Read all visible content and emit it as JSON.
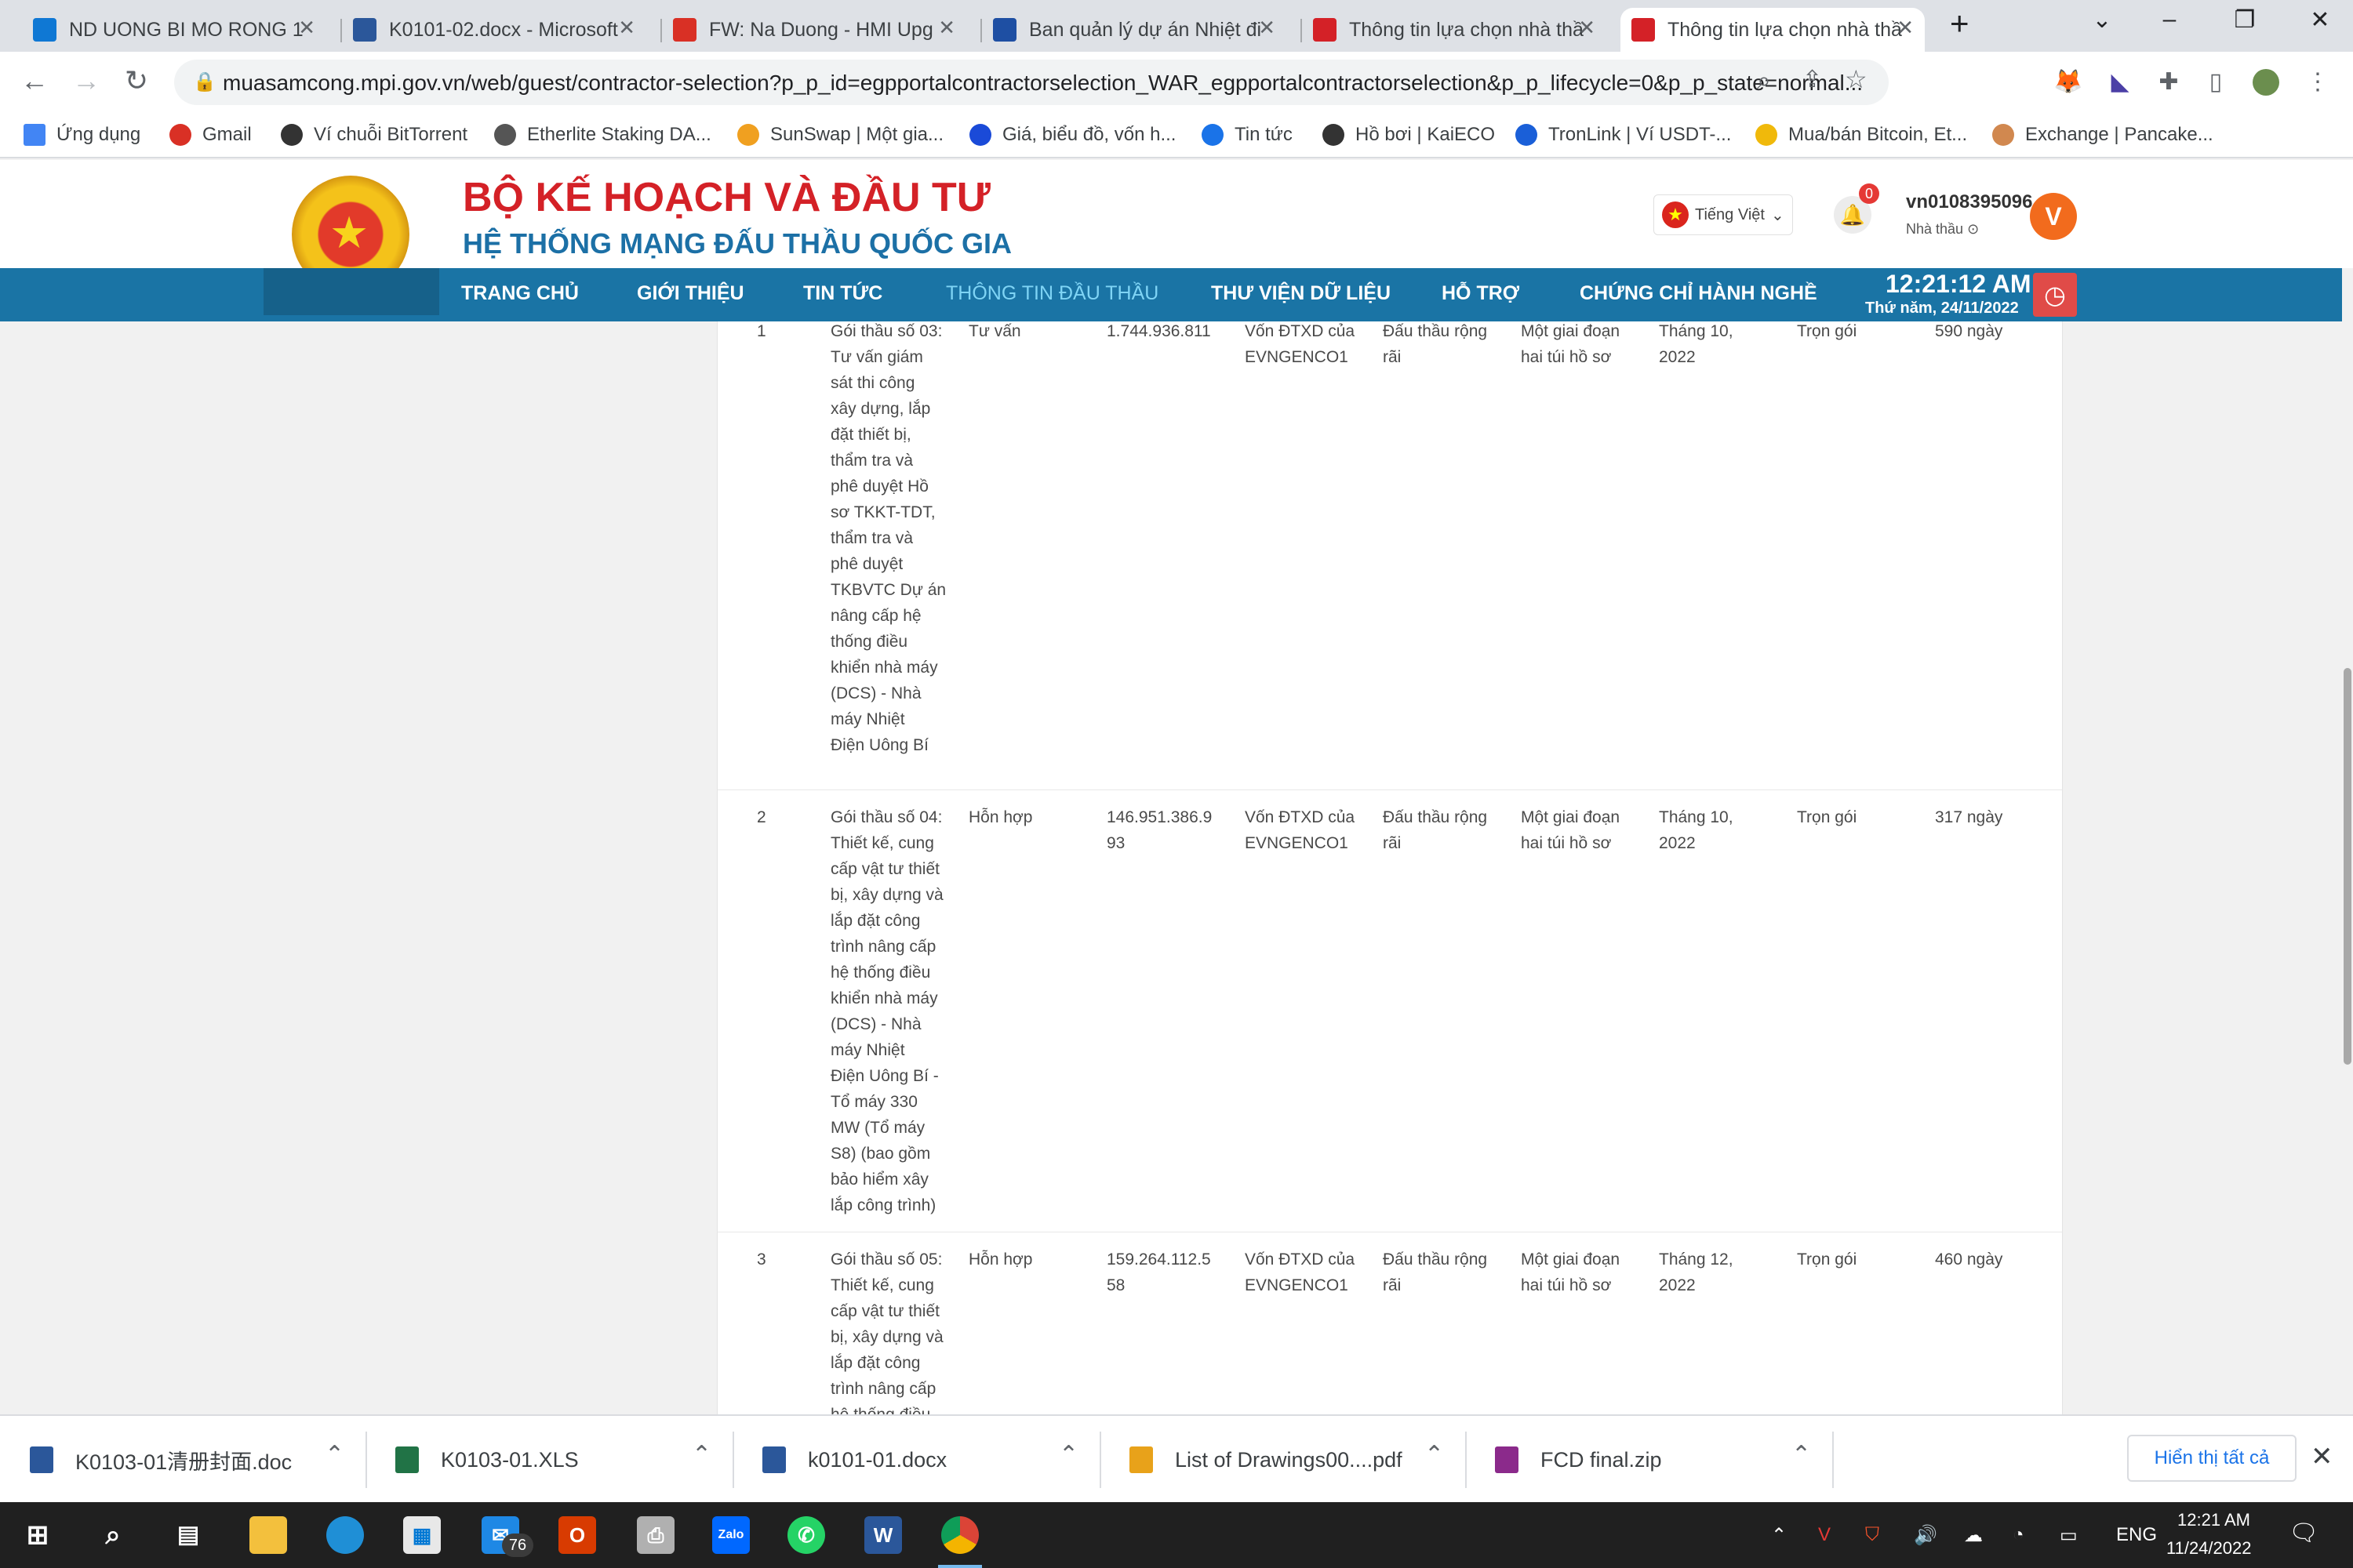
{
  "browser": {
    "tabs": [
      {
        "label": "ND UONG BI MO RONG 1",
        "icon": "onedrive-icon",
        "color": "#0f78d4"
      },
      {
        "label": "K0101-02.docx - Microsoft",
        "icon": "word-icon",
        "color": "#2b579a"
      },
      {
        "label": "FW: Na Duong - HMI Upg",
        "icon": "gmail-icon",
        "color": "#d93025"
      },
      {
        "label": "Ban quản lý dự án Nhiệt đi",
        "icon": "evn-icon",
        "color": "#1e4fa3"
      },
      {
        "label": "Thông tin lựa chọn nhà thầ",
        "icon": "emblem-icon",
        "color": "#d42127"
      },
      {
        "label": "Thông tin lựa chọn nhà thầ",
        "icon": "emblem-icon",
        "color": "#d42127"
      }
    ],
    "url": "muasamcong.mpi.gov.vn/web/guest/contractor-selection?p_p_id=egpportalcontractorselection_WAR_egpportalcontractorselection&p_p_lifecycle=0&p_p_state=normal...",
    "bookmarks": [
      {
        "label": "Ứng dụng",
        "color": "#4285f4"
      },
      {
        "label": "Gmail",
        "color": "#d93025"
      },
      {
        "label": "Ví chuỗi BitTorrent",
        "color": "#333333"
      },
      {
        "label": "Etherlite Staking DA...",
        "color": "#555555"
      },
      {
        "label": "SunSwap | Một gia...",
        "color": "#f0a020"
      },
      {
        "label": "Giá, biểu đồ, vốn h...",
        "color": "#1a4ad8"
      },
      {
        "label": "Tin tức",
        "color": "#1a73e8"
      },
      {
        "label": "Hồ bơi | KaiECO",
        "color": "#333333"
      },
      {
        "label": "TronLink | Ví USDT-...",
        "color": "#1a5fd8"
      },
      {
        "label": "Mua/bán Bitcoin, Et...",
        "color": "#f0b90b"
      },
      {
        "label": "Exchange | Pancake...",
        "color": "#d1884f"
      }
    ]
  },
  "site": {
    "ministry": "BỘ KẾ HOẠCH VÀ ĐẦU TƯ",
    "system": "HỆ THỐNG MẠNG ĐẤU THẦU QUỐC GIA",
    "language": "Tiếng Việt",
    "notifications": "0",
    "username": "vn0108395096",
    "role": "Nhà thầu",
    "avatar_letter": "V",
    "nav": [
      "TRANG CHỦ",
      "GIỚI THIỆU",
      "TIN TỨC",
      "THÔNG TIN ĐẦU THẦU",
      "THƯ VIỆN DỮ LIỆU",
      "HỖ TRỢ",
      "CHỨNG CHỈ HÀNH NGHỀ"
    ],
    "time": "12:21:12 AM",
    "date": "Thứ năm, 24/11/2022"
  },
  "table": {
    "rows": [
      {
        "stt": "1",
        "name_lines": [
          "Gói thầu số 03:",
          "Tư vấn giám",
          "sát thi công",
          "xây dựng, lắp",
          "đặt thiết bị,",
          "thẩm tra và",
          "phê duyệt Hồ",
          "sơ TKKT-TDT,",
          "thẩm tra và",
          "phê duyệt",
          "TKBVTC Dự án",
          "nâng cấp hệ",
          "thống điều",
          "khiển nhà máy",
          "(DCS) - Nhà",
          "máy Nhiệt",
          "Điện Uông Bí"
        ],
        "field": "Tư vấn",
        "price_lines": [
          "1.744.936.811"
        ],
        "fund_lines": [
          "Vốn ĐTXD của",
          "EVNGENCO1"
        ],
        "method_lines": [
          "Đấu thầu rộng",
          "rãi"
        ],
        "procedure_lines": [
          "Một giai đoạn",
          "hai túi hồ sơ"
        ],
        "time_lines": [
          "Tháng 10,",
          "2022"
        ],
        "contract": "Trọn gói",
        "duration": "590 ngày"
      },
      {
        "stt": "2",
        "name_lines": [
          "Gói thầu số 04:",
          "Thiết kế, cung",
          "cấp vật tư thiết",
          "bị, xây dựng và",
          "lắp đặt công",
          "trình nâng cấp",
          "hệ thống điều",
          "khiển nhà máy",
          "(DCS) - Nhà",
          "máy Nhiệt",
          "Điện Uông Bí -",
          "Tổ máy 330",
          "MW (Tổ máy",
          "S8) (bao gồm",
          "bảo hiểm xây",
          "lắp công trình)"
        ],
        "field": "Hỗn hợp",
        "price_lines": [
          "146.951.386.9",
          "93"
        ],
        "fund_lines": [
          "Vốn ĐTXD của",
          "EVNGENCO1"
        ],
        "method_lines": [
          "Đấu thầu rộng",
          "rãi"
        ],
        "procedure_lines": [
          "Một giai đoạn",
          "hai túi hồ sơ"
        ],
        "time_lines": [
          "Tháng 10,",
          "2022"
        ],
        "contract": "Trọn gói",
        "duration": "317 ngày"
      },
      {
        "stt": "3",
        "name_lines": [
          "Gói thầu số 05:",
          "Thiết kế, cung",
          "cấp vật tư thiết",
          "bị, xây dựng và",
          "lắp đặt công",
          "trình nâng cấp",
          "hệ thống điều"
        ],
        "field": "Hỗn hợp",
        "price_lines": [
          "159.264.112.5",
          "58"
        ],
        "fund_lines": [
          "Vốn ĐTXD của",
          "EVNGENCO1"
        ],
        "method_lines": [
          "Đấu thầu rộng",
          "rãi"
        ],
        "procedure_lines": [
          "Một giai đoạn",
          "hai túi hồ sơ"
        ],
        "time_lines": [
          "Tháng 12,",
          "2022"
        ],
        "contract": "Trọn gói",
        "duration": "460 ngày"
      }
    ]
  },
  "downloads": {
    "items": [
      {
        "name": "K0103-01清册封面.doc",
        "icon": "word-file-icon",
        "color": "#2b579a"
      },
      {
        "name": "K0103-01.XLS",
        "icon": "excel-file-icon",
        "color": "#217346"
      },
      {
        "name": "k0101-01.docx",
        "icon": "word-file-icon",
        "color": "#2b579a"
      },
      {
        "name": "List of Drawings00....pdf",
        "icon": "pdf-file-icon",
        "color": "#e8a21a"
      },
      {
        "name": "FCD final.zip",
        "icon": "zip-file-icon",
        "color": "#8b2a8b"
      }
    ],
    "show_all": "Hiển thị tất cả"
  },
  "taskbar": {
    "mail_badge": "76",
    "lang": "ENG",
    "time": "12:21 AM",
    "date": "11/24/2022"
  }
}
